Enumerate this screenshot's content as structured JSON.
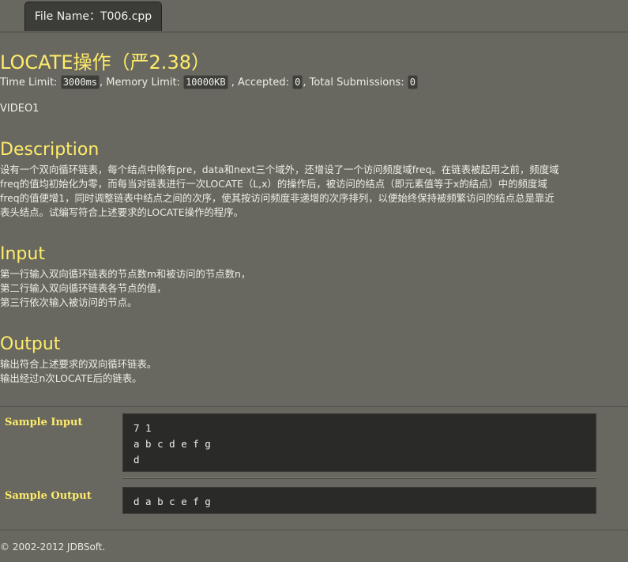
{
  "tab": {
    "label": "File Name：T006.cpp"
  },
  "problem": {
    "title": "LOCATE操作（严2.38）",
    "time_limit_label": "Time Limit: ",
    "time_limit": "3000ms",
    "memory_limit_label": ", Memory Limit: ",
    "memory_limit": "10000KB",
    "accepted_label": " , Accepted: ",
    "accepted": "0",
    "submissions_label": ", Total Submissions: ",
    "submissions": "0",
    "source": "VIDEO1"
  },
  "sections": {
    "description": {
      "heading": "Description",
      "lines": [
        "设有一个双向循环链表，每个结点中除有pre，data和next三个域外，还增设了一个访问频度域freq。在链表被起用之前，频度域",
        "freq的值均初始化为零，而每当对链表进行一次LOCATE（L,x）的操作后，被访问的结点（即元素值等于x的结点）中的频度域",
        "freq的值便增1，同时调整链表中结点之间的次序，使其按访问频度非递增的次序排列，以便始终保持被频繁访问的结点总是靠近",
        "表头结点。试编写符合上述要求的LOCATE操作的程序。"
      ]
    },
    "input": {
      "heading": "Input",
      "lines": [
        "第一行输入双向循环链表的节点数m和被访问的节点数n，",
        "第二行输入双向循环链表各节点的值，",
        "第三行依次输入被访问的节点。"
      ]
    },
    "output": {
      "heading": "Output",
      "lines": [
        "输出符合上述要求的双向循环链表。",
        "输出经过n次LOCATE后的链表。"
      ]
    }
  },
  "samples": {
    "input_label": "Sample Input",
    "input_lines": [
      "7 1",
      "a b c d e f g",
      "d"
    ],
    "output_label": "Sample Output",
    "output_lines": [
      "d a b c e f g"
    ]
  },
  "footer": {
    "copyright": "© 2002-2012  JDBSoft."
  }
}
